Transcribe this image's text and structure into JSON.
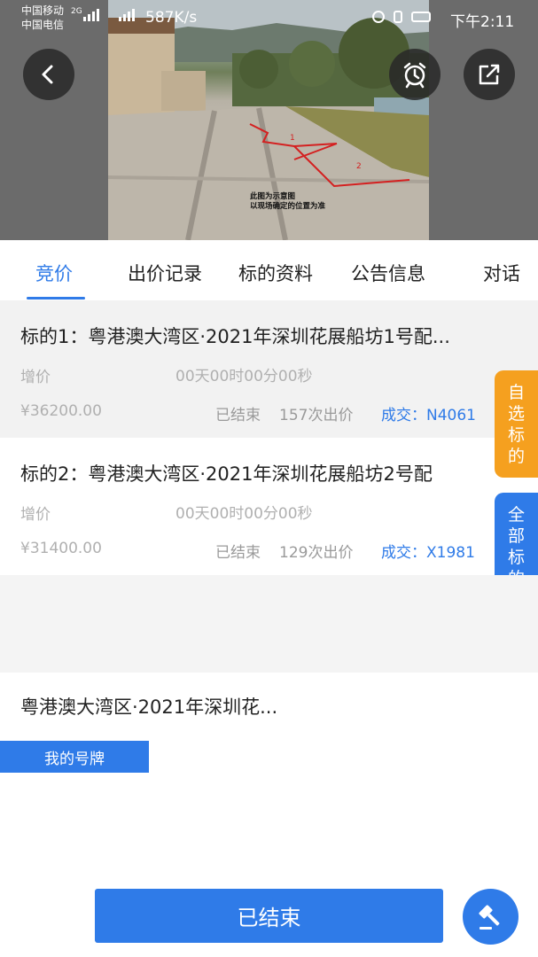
{
  "status_bar": {
    "carrier_1": "中国移动",
    "carrier_2": "中国电信",
    "network": "2G",
    "speed": "587K/s",
    "time": "下午2:11"
  },
  "hero": {
    "caption_line_1": "此图为示意图",
    "caption_line_2": "以现场确定的位置为准",
    "marker_1": "1",
    "marker_2": "2"
  },
  "header_buttons": {
    "back": "back-icon",
    "alarm": "alarm-clock-icon",
    "share": "share-icon"
  },
  "tabs": [
    {
      "label": "竞价",
      "active": true
    },
    {
      "label": "出价记录",
      "active": false
    },
    {
      "label": "标的资料",
      "active": false
    },
    {
      "label": "公告信息",
      "active": false
    },
    {
      "label": "对话",
      "active": false
    }
  ],
  "lots": [
    {
      "title": "标的1：粤港澳大湾区·2021年深圳花展船坊1号配...",
      "label": "增价",
      "timer": "00天00时00分00秒",
      "price": "¥36200.00",
      "status": "已结束",
      "bids": "157次出价",
      "deal": "成交：N4061"
    },
    {
      "title": "标的2：粤港澳大湾区·2021年深圳花展船坊2号配",
      "label": "增价",
      "timer": "00天00时00分00秒",
      "price": "¥31400.00",
      "status": "已结束",
      "bids": "129次出价",
      "deal": "成交：X1981"
    }
  ],
  "side_tabs": {
    "favorites": "自选标的",
    "all": "全部标的"
  },
  "auction": {
    "title": "粤港澳大湾区·2021年深圳花...",
    "my_paddle": "我的号牌"
  },
  "footer": {
    "main_button": "已结束",
    "hammer": "gavel-icon"
  },
  "colors": {
    "accent": "#2f7be8",
    "orange_tab": "#f5a01f",
    "muted_text": "#b0b0b0"
  }
}
